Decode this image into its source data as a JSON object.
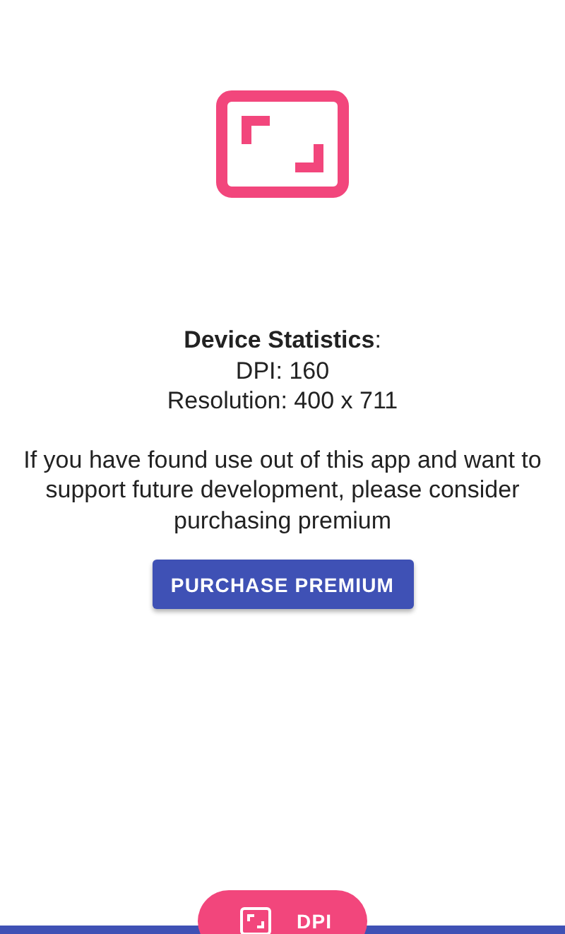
{
  "stats": {
    "heading": "**Device Statistics**:",
    "lines": [
      "DPI: 160",
      "Resolution: 400 x 711"
    ]
  },
  "message": "If you have found use out of this app and want to support future development, please consider purchasing premium",
  "purchase_button": "PURCHASE PREMIUM",
  "bottom_action": {
    "label": "DPI"
  }
}
